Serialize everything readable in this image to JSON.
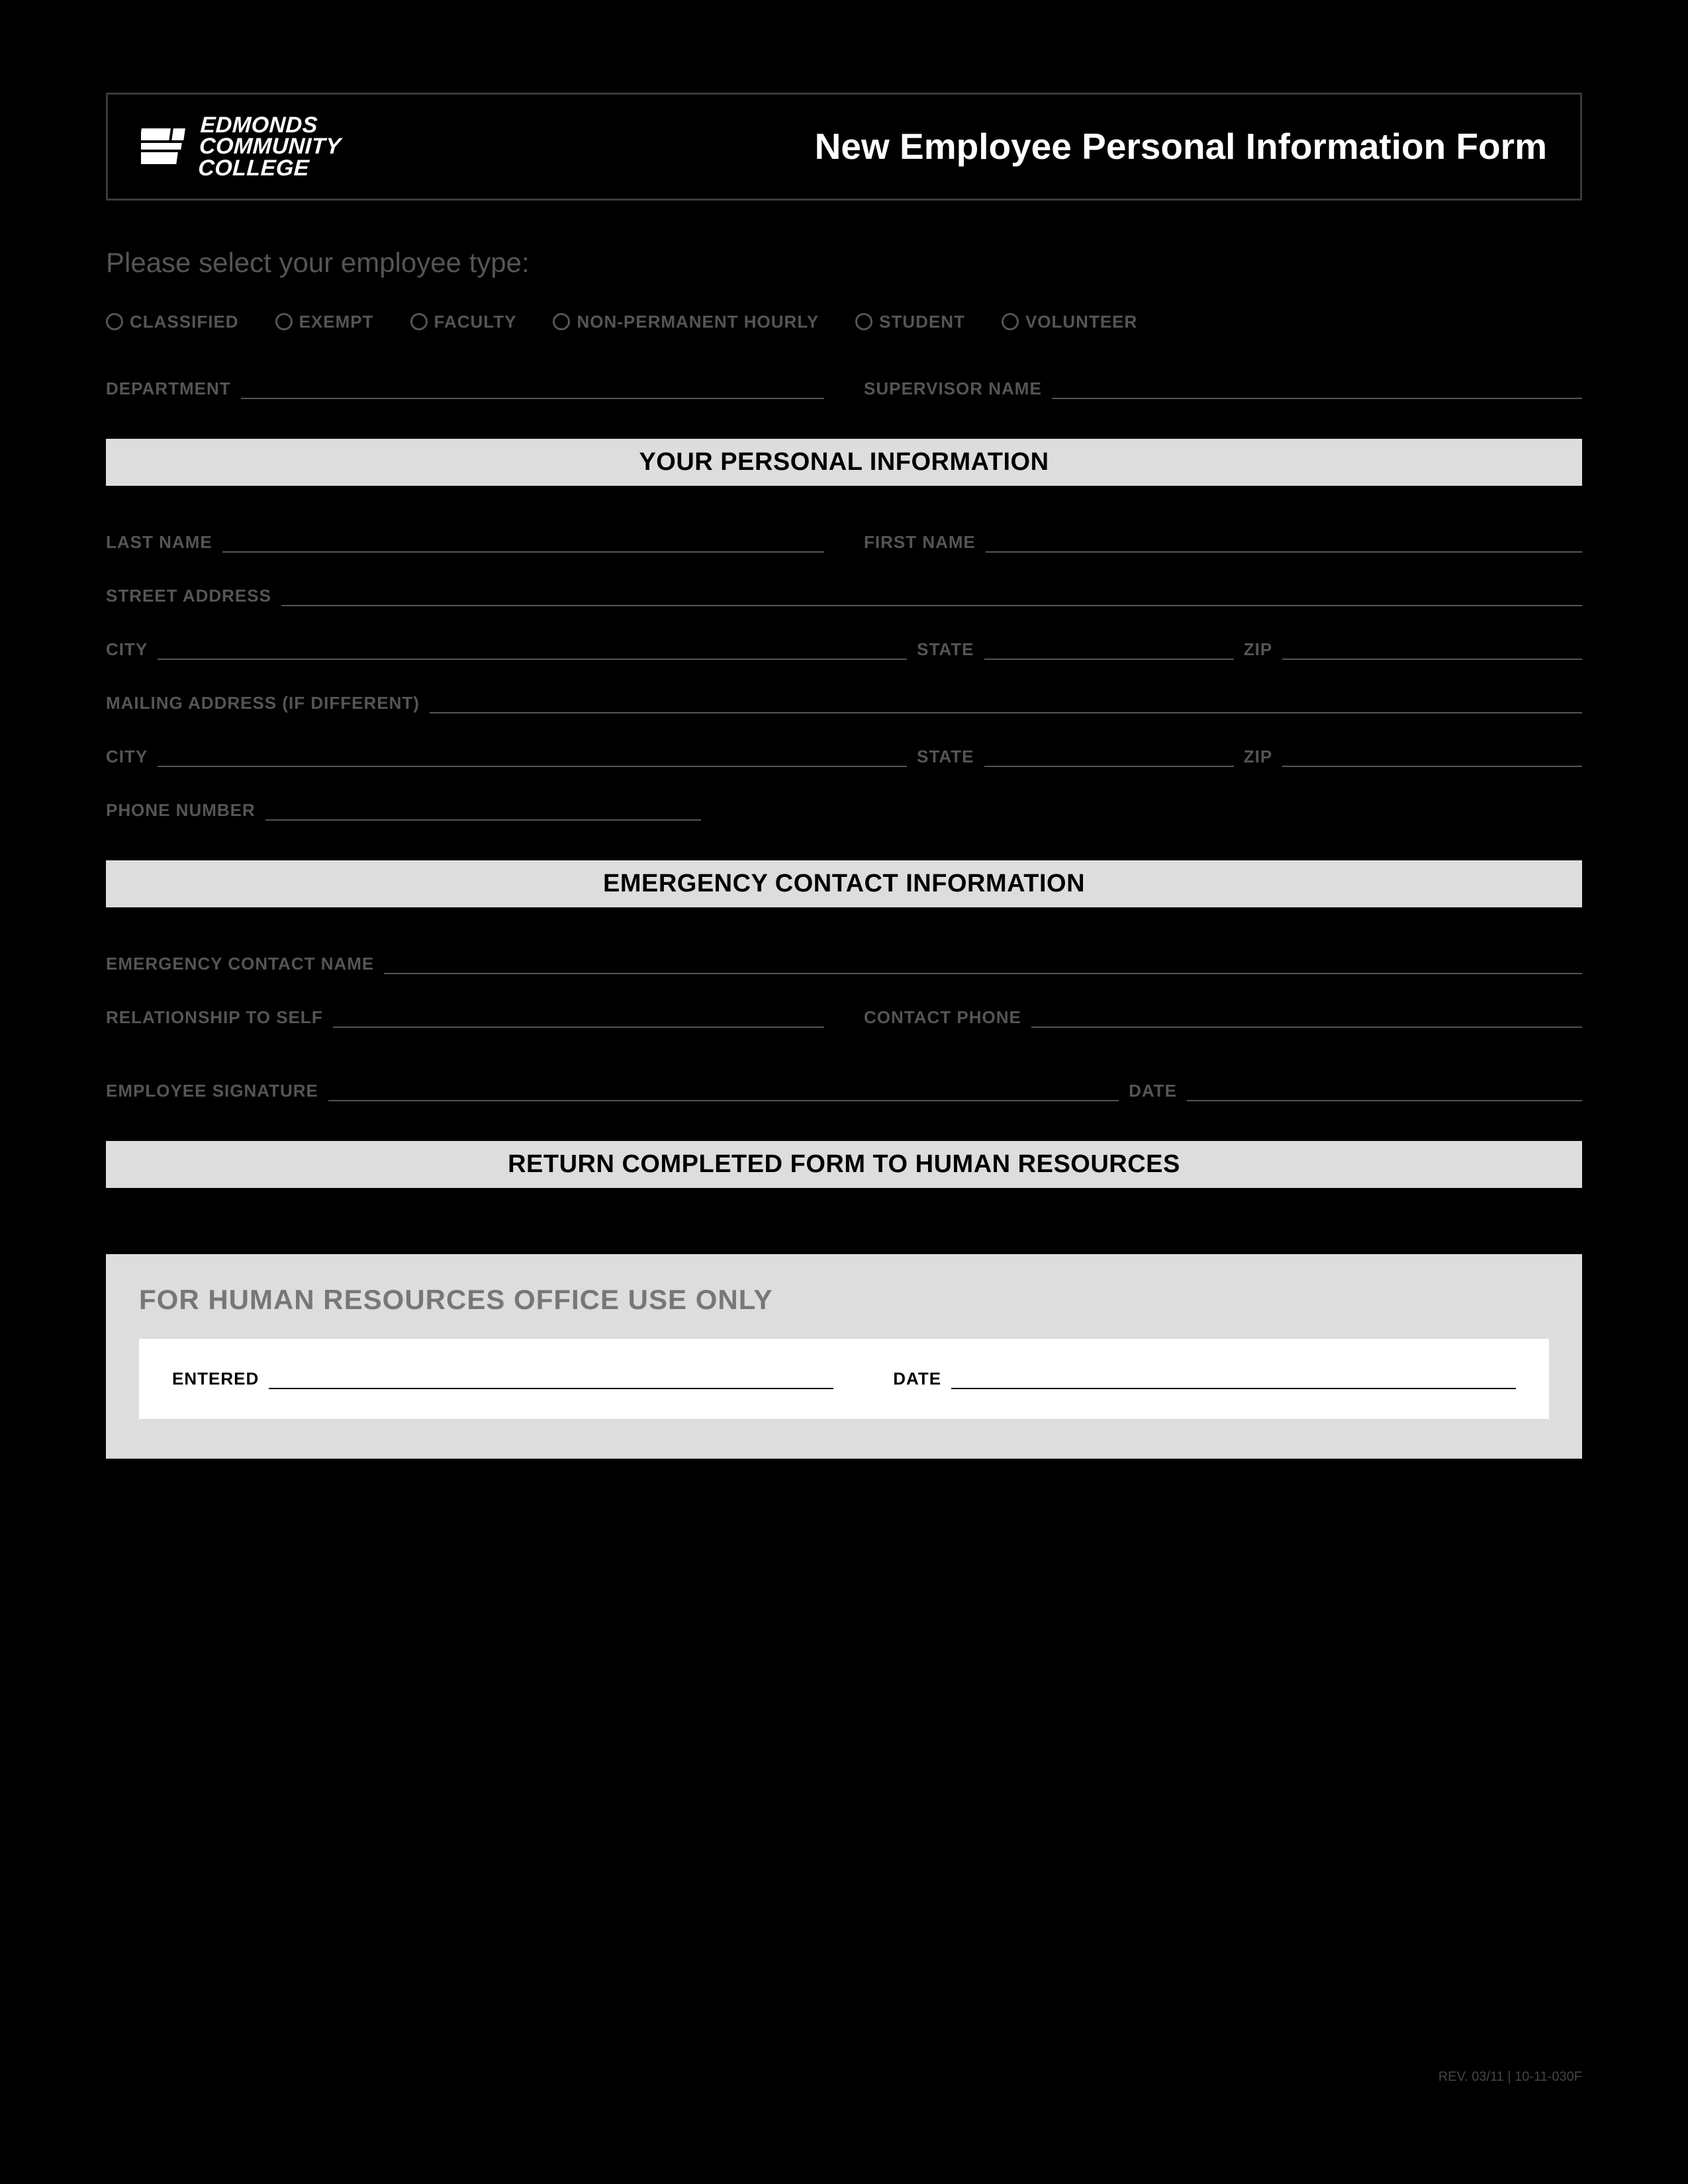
{
  "header": {
    "org_line1": "EDMONDS",
    "org_line2": "COMMUNITY",
    "org_line3": "COLLEGE",
    "title": "New Employee Personal Information Form"
  },
  "intro": "Please select your employee type:",
  "employee_types": [
    "CLASSIFIED",
    "EXEMPT",
    "FACULTY",
    "NON-PERMANENT HOURLY",
    "STUDENT",
    "VOLUNTEER"
  ],
  "fields": {
    "department": "DEPARTMENT",
    "supervisor": "SUPERVISOR NAME"
  },
  "sections": {
    "personal": "YOUR PERSONAL INFORMATION",
    "emergency": "EMERGENCY CONTACT INFORMATION",
    "return": "RETURN COMPLETED FORM TO HUMAN RESOURCES"
  },
  "personal": {
    "last_name": "LAST NAME",
    "first_name": "FIRST NAME",
    "street": "STREET ADDRESS",
    "city": "CITY",
    "state": "STATE",
    "zip": "ZIP",
    "mailing": "MAILING ADDRESS (IF DIFFERENT)",
    "phone": "PHONE NUMBER"
  },
  "emergency": {
    "name": "EMERGENCY CONTACT NAME",
    "relationship": "RELATIONSHIP TO SELF",
    "phone": "CONTACT PHONE",
    "signature": "EMPLOYEE SIGNATURE",
    "date": "DATE"
  },
  "hr": {
    "title": "FOR HUMAN RESOURCES OFFICE USE ONLY",
    "entered": "ENTERED",
    "date": "DATE"
  },
  "footer": "REV. 03/11 | 10-11-030F"
}
